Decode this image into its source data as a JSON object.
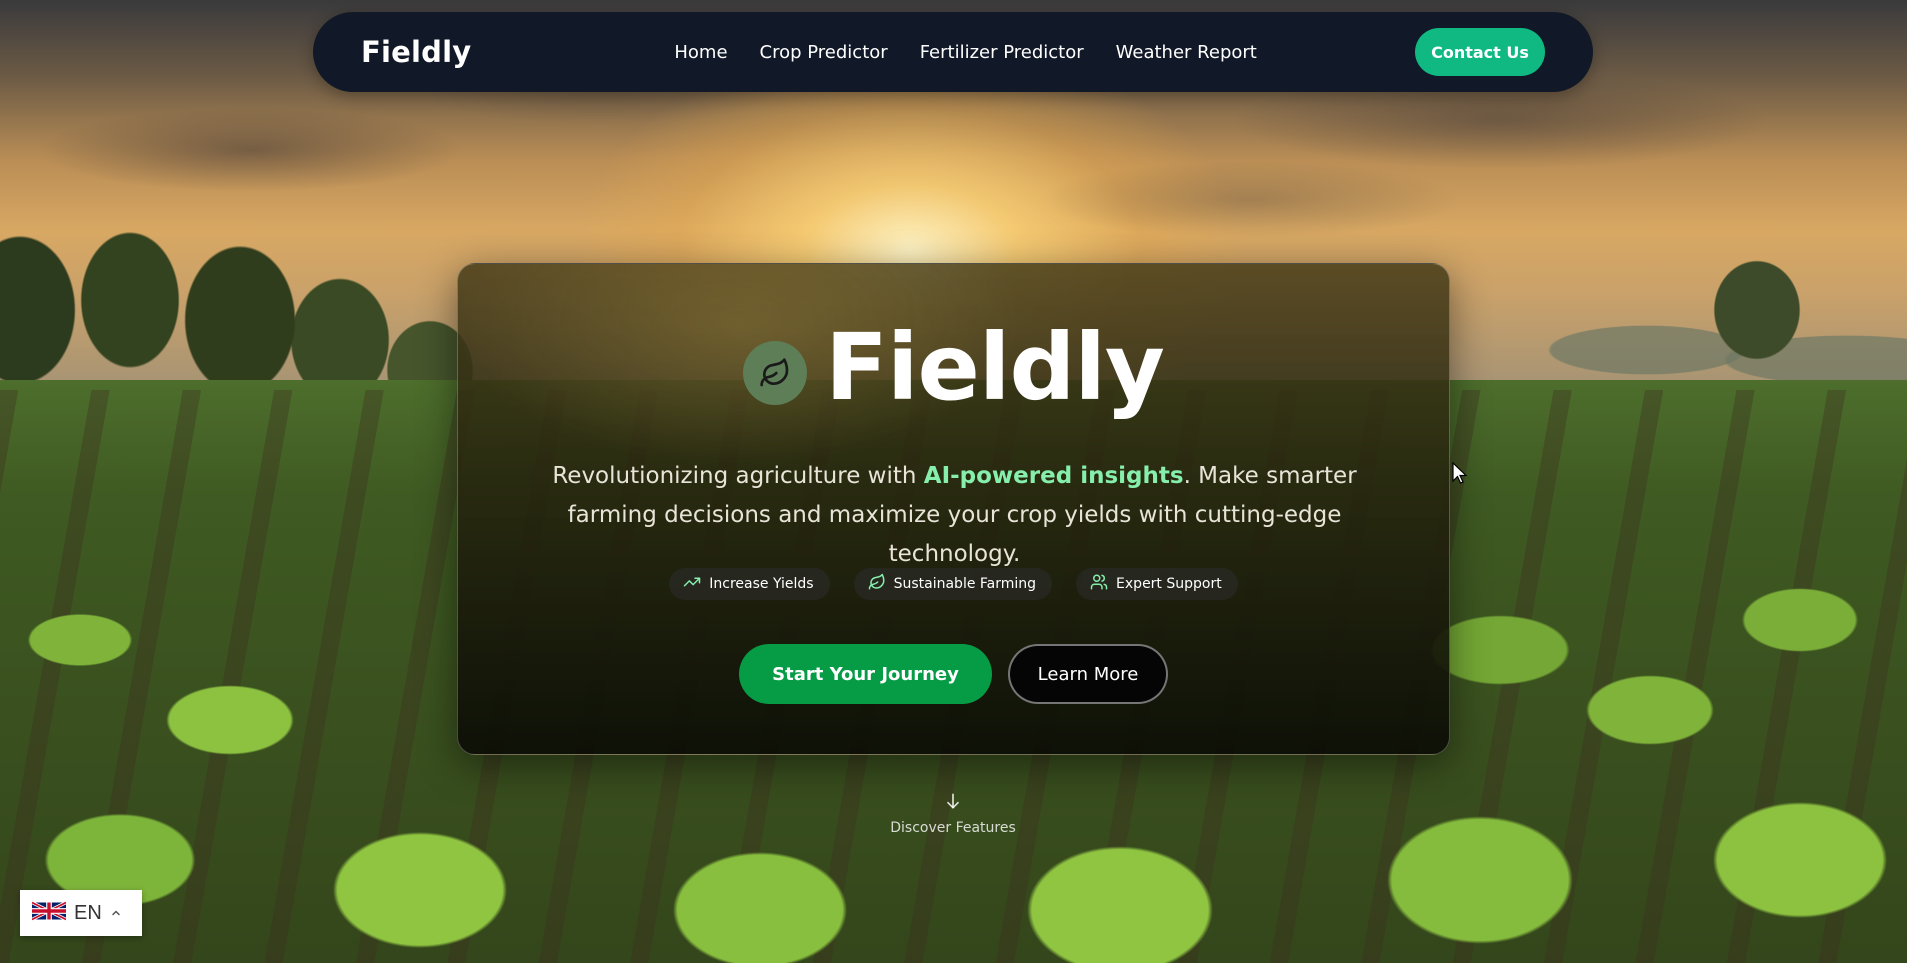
{
  "navbar": {
    "brand": "Fieldly",
    "links": [
      "Home",
      "Crop Predictor",
      "Fertilizer Predictor",
      "Weather Report"
    ],
    "contact_label": "Contact Us"
  },
  "hero": {
    "title": "Fieldly",
    "logo_icon": "leaf-icon",
    "desc_before": "Revolutionizing agriculture with ",
    "desc_highlight": "AI-powered insights",
    "desc_after": ". Make smarter farming decisions and maximize your crop yields with cutting-edge technology.",
    "badges": [
      {
        "icon": "trending-up-icon",
        "label": "Increase Yields"
      },
      {
        "icon": "leaf-icon",
        "label": "Sustainable Farming"
      },
      {
        "icon": "users-icon",
        "label": "Expert Support"
      }
    ],
    "primary_cta": "Start Your Journey",
    "secondary_cta": "Learn More"
  },
  "discover": {
    "icon": "arrow-down-icon",
    "label": "Discover Features"
  },
  "language": {
    "code": "EN",
    "flag_icon": "uk-flag-icon",
    "chevron_icon": "chevron-up-icon"
  },
  "colors": {
    "navbar_bg": "#111827",
    "accent": "#10b981",
    "primary_button": "#059c45",
    "highlight_text": "#86efac"
  }
}
